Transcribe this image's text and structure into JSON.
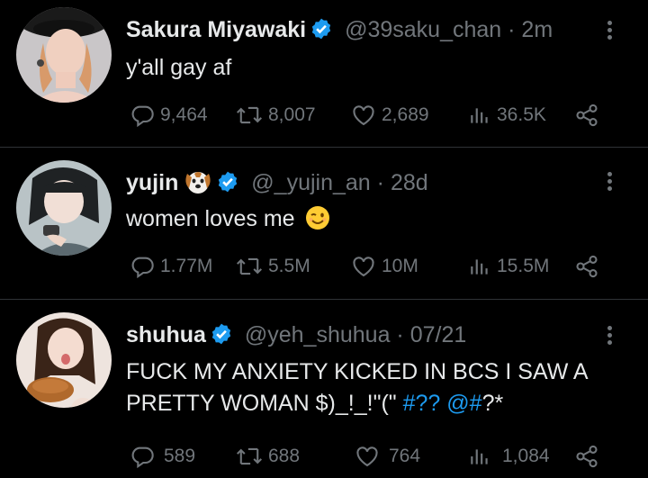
{
  "tweets": [
    {
      "name": "Sakura Miyawaki",
      "handle": "@39saku_chan",
      "separator": "·",
      "time": "2m",
      "text": "y'all gay af",
      "replies": "9,464",
      "retweets": "8,007",
      "likes": "2,689",
      "views": "36.5K",
      "avatar_icon": "profile-photo"
    },
    {
      "name": "yujin",
      "name_emoji": "dog-face-emoji",
      "handle": "@_yujin_an",
      "separator": "·",
      "time": "28d",
      "text": "women loves me",
      "text_emoji": "winking-face-emoji",
      "replies": "1.77M",
      "retweets": "5.5M",
      "likes": "10M",
      "views": "15.5M",
      "avatar_icon": "profile-photo"
    },
    {
      "name": "shuhua",
      "handle": "@yeh_shuhua",
      "separator": "·",
      "time": "07/21",
      "text_line1": "FUCK MY ANXIETY KICKED IN BCS I SAW A",
      "text_line2": "PRETTY WOMAN $)_!_!\"(\"",
      "hashtag": "#??",
      "mention": "@#",
      "text_tail": "?*",
      "replies": "589",
      "retweets": "688",
      "likes": "764",
      "views": "1,084",
      "avatar_icon": "profile-photo"
    }
  ],
  "colors": {
    "background": "#000000",
    "text": "#e7e9ea",
    "muted": "#71767b",
    "accent": "#1d9bf0",
    "divider": "#2f3336"
  }
}
